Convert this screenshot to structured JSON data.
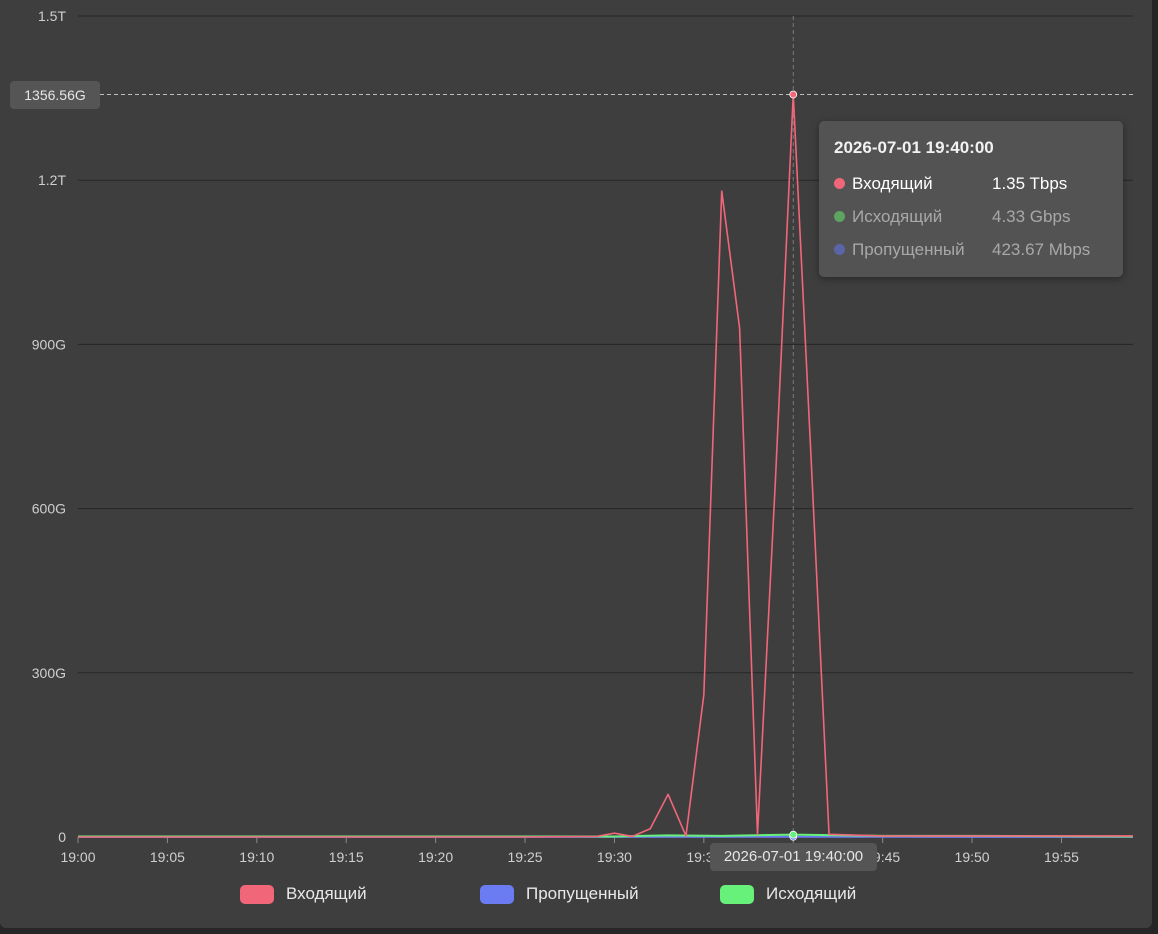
{
  "chart_data": {
    "type": "line",
    "x_ticks": [
      "19:00",
      "19:05",
      "19:10",
      "19:15",
      "19:20",
      "19:25",
      "19:30",
      "19:35",
      "19:40",
      "19:45",
      "19:50",
      "19:55"
    ],
    "y_ticks": [
      "0",
      "300G",
      "600G",
      "900G",
      "1.2T",
      "1.5T"
    ],
    "y_unit": "Gbps",
    "ylim": [
      0,
      1500
    ],
    "xlim_minutes": [
      0,
      59
    ],
    "grid": true,
    "legend_position": "bottom",
    "series": [
      {
        "name": "Входящий",
        "color": "#f2667a",
        "x": [
          "19:00",
          "19:05",
          "19:10",
          "19:15",
          "19:20",
          "19:25",
          "19:29",
          "19:30",
          "19:31",
          "19:32",
          "19:33",
          "19:34",
          "19:35",
          "19:36",
          "19:37",
          "19:38",
          "19:39",
          "19:40",
          "19:41",
          "19:42",
          "19:45",
          "19:50",
          "19:55",
          "19:59"
        ],
        "values": [
          0,
          0,
          0,
          0,
          0,
          0,
          1,
          7,
          1,
          15,
          78,
          2,
          260,
          1180,
          930,
          5,
          650,
          1356.56,
          690,
          5,
          2,
          2,
          2,
          2
        ]
      },
      {
        "name": "Пропущенный",
        "color": "#6b7cf2",
        "x": [
          "19:00",
          "19:10",
          "19:20",
          "19:30",
          "19:40",
          "19:50",
          "19:59"
        ],
        "values": [
          0.3,
          0.3,
          0.3,
          0.3,
          0.42,
          0.3,
          0.3
        ]
      },
      {
        "name": "Исходящий",
        "color": "#67f07a",
        "x": [
          "19:00",
          "19:10",
          "19:20",
          "19:30",
          "19:33",
          "19:36",
          "19:40",
          "19:45",
          "19:50",
          "19:59"
        ],
        "values": [
          1,
          1,
          1,
          1,
          3,
          2,
          4.33,
          2,
          2,
          1
        ]
      }
    ],
    "crosshair": {
      "x": "19:40",
      "y_label": "1356.56G",
      "x_label": "2026-07-01 19:40:00"
    }
  },
  "tooltip": {
    "title": "2026-07-01 19:40:00",
    "rows": [
      {
        "name": "Входящий",
        "value": "1.35 Tbps",
        "color": "#f2667a"
      },
      {
        "name": "Исходящий",
        "value": "4.33 Gbps",
        "color": "#5ea35f"
      },
      {
        "name": "Пропущенный",
        "value": "423.67 Mbps",
        "color": "#5b64a8"
      }
    ]
  },
  "legend": [
    {
      "label": "Входящий",
      "color": "#f2667a"
    },
    {
      "label": "Пропущенный",
      "color": "#6b7cf2"
    },
    {
      "label": "Исходящий",
      "color": "#67f07a"
    }
  ]
}
